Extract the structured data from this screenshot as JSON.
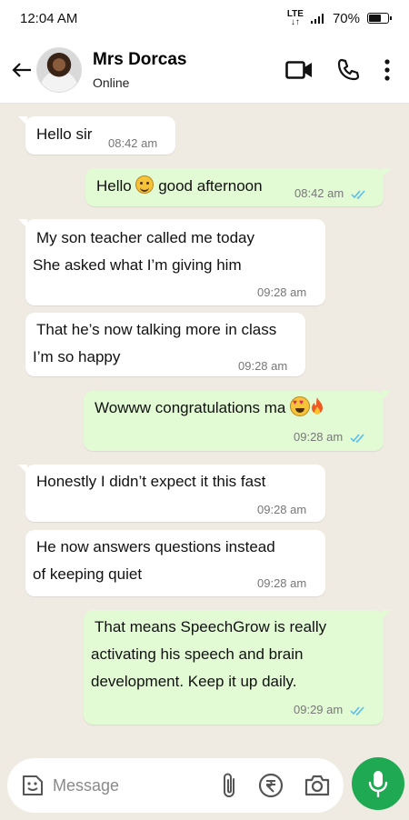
{
  "status_bar": {
    "time": "12:04 AM",
    "network": "LTE",
    "battery": "70%",
    "battery_level": 0.7
  },
  "header": {
    "contact_name": "Mrs Dorcas",
    "contact_status": "Online"
  },
  "messages": [
    {
      "dir": "in",
      "lines": [
        "Hello sir"
      ],
      "time": "08:42 am"
    },
    {
      "dir": "out",
      "before_emoji": "Hello ",
      "after_emoji": " good afternoon",
      "time": "08:42 am"
    },
    {
      "dir": "in",
      "lines": [
        "My son teacher called me today",
        "She asked what I’m giving him"
      ],
      "time": "09:28 am"
    },
    {
      "dir": "in",
      "lines": [
        "That he’s now talking more in class",
        "I’m so happy"
      ],
      "time": "09:28 am"
    },
    {
      "dir": "out",
      "lines": [
        "Wowww congratulations ma "
      ],
      "time": "09:28 am"
    },
    {
      "dir": "in",
      "lines": [
        "Honestly I didn’t expect it this fast"
      ],
      "time": "09:28 am"
    },
    {
      "dir": "in",
      "lines": [
        "He now answers questions instead",
        "of keeping quiet"
      ],
      "time": "09:28 am"
    },
    {
      "dir": "out",
      "lines": [
        "That means SpeechGrow is really",
        "activating his speech and brain",
        "development. Keep it up daily."
      ],
      "time": "09:29 am"
    }
  ],
  "composer": {
    "placeholder": "Message"
  },
  "colors": {
    "accent": "#1ea952",
    "tick_blue": "#53bdeb",
    "outgoing_bubble": "#e2fbd5"
  }
}
